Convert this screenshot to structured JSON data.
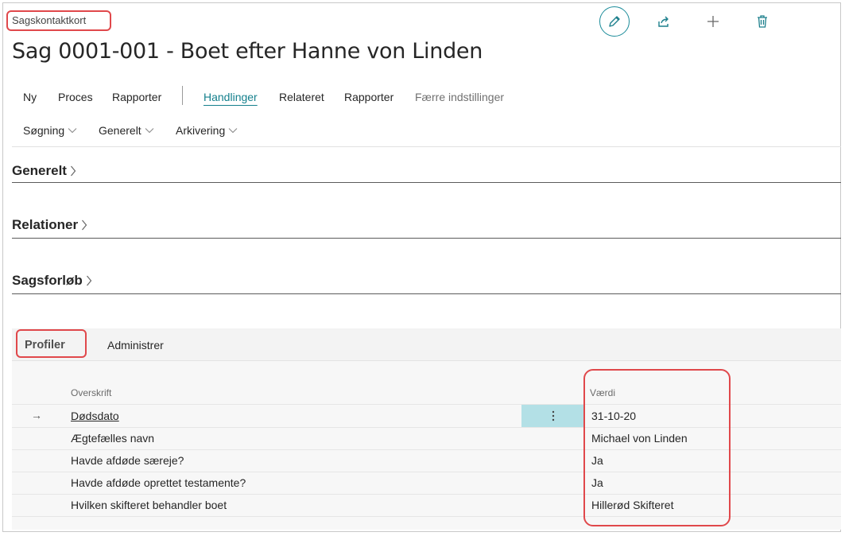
{
  "header": {
    "page_type": "Sagskontaktkort",
    "title": "Sag 0001-001 - Boet efter Hanne von Linden"
  },
  "top_actions": [
    {
      "name": "edit",
      "icon": "pencil-icon"
    },
    {
      "name": "share",
      "icon": "share-icon"
    },
    {
      "name": "new",
      "icon": "plus-icon"
    },
    {
      "name": "delete",
      "icon": "trash-icon"
    }
  ],
  "menu": {
    "primary": [
      "Ny",
      "Proces",
      "Rapporter"
    ],
    "secondary": [
      "Handlinger",
      "Relateret",
      "Rapporter"
    ],
    "fewer": "Færre indstillinger",
    "submenu": [
      "Søgning",
      "Generelt",
      "Arkivering"
    ]
  },
  "sections": [
    "Generelt",
    "Relationer",
    "Sagsforløb"
  ],
  "part": {
    "tabs": [
      "Profiler",
      "Administrer"
    ],
    "columns": {
      "heading": "Overskrift",
      "value": "Værdi"
    },
    "rows": [
      {
        "heading": "Dødsdato",
        "value": "31-10-20"
      },
      {
        "heading": "Ægtefælles navn",
        "value": "Michael von Linden"
      },
      {
        "heading": "Havde afdøde særeje?",
        "value": "Ja"
      },
      {
        "heading": "Havde afdøde oprettet testamente?",
        "value": "Ja"
      },
      {
        "heading": "Hvilken skifteret behandler boet",
        "value": "Hillerød Skifteret"
      }
    ]
  },
  "colors": {
    "accent": "#15808d",
    "callout": "#e0484b",
    "row_highlight": "#b3e0e6"
  }
}
